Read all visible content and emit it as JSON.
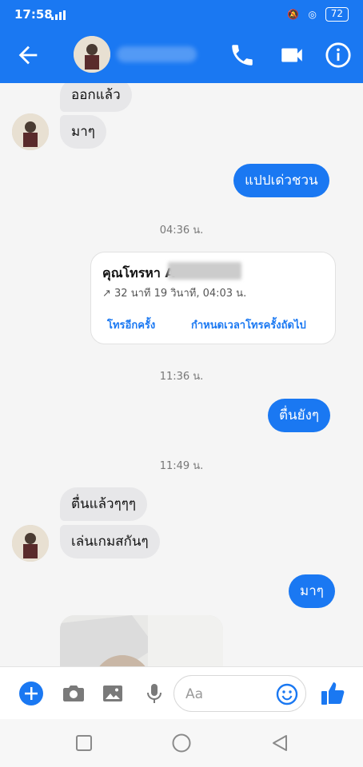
{
  "status": {
    "time": "17:58",
    "network": "4G",
    "battery": "72"
  },
  "header": {
    "icons": [
      "back-arrow-icon",
      "phone-icon",
      "video-icon",
      "info-icon"
    ],
    "accent": "#1a78f2"
  },
  "messages": [
    {
      "direction": "in",
      "text": "ออกแล้ว"
    },
    {
      "direction": "in",
      "text": "มาๆ"
    },
    {
      "direction": "out",
      "text": "แปปเด่วชวน"
    },
    {
      "direction": "time",
      "text": "04:36 น."
    },
    {
      "direction": "call"
    },
    {
      "direction": "time",
      "text": "11:36 น."
    },
    {
      "direction": "out",
      "text": "ตื่นยังๆ"
    },
    {
      "direction": "time",
      "text": "11:49 น."
    },
    {
      "direction": "in",
      "text": "ตื่นแล้วๆๆๆ"
    },
    {
      "direction": "in",
      "text": "เล่นเกมสกันๆ"
    },
    {
      "direction": "out",
      "text": "มาๆ"
    }
  ],
  "call_card": {
    "title": "คุณโทรหา A",
    "meta": "↗ 32 นาที 19 วินาที, 04:03 น.",
    "action_again": "โทรอีกครั้ง",
    "action_schedule": "กำหนดเวลาโทรครั้งถัดไป"
  },
  "composer": {
    "placeholder": "Aa",
    "icons": [
      "plus-icon",
      "camera-icon",
      "image-icon",
      "microphone-icon",
      "emoji-icon",
      "like-icon"
    ]
  },
  "navbar": {
    "icons": [
      "recent-apps-icon",
      "home-icon",
      "back-icon"
    ]
  }
}
